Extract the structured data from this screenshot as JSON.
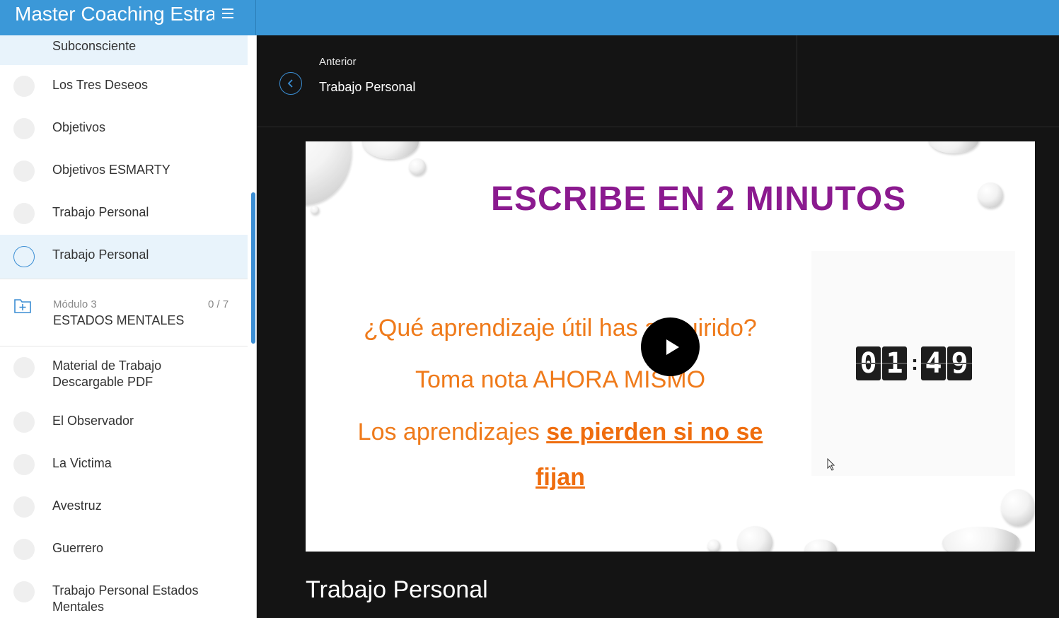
{
  "app": {
    "title": "Master Coaching Estratégico"
  },
  "sidebar": {
    "items_top": [
      {
        "label": "Subconsciente",
        "active": false
      },
      {
        "label": "Los Tres Deseos",
        "active": false
      },
      {
        "label": "Objetivos",
        "active": false
      },
      {
        "label": "Objetivos ESMARTY",
        "active": false
      },
      {
        "label": "Trabajo Personal",
        "active": false
      },
      {
        "label": "Trabajo Personal",
        "active": true
      }
    ],
    "module": {
      "label": "Módulo 3",
      "count": "0 / 7",
      "title": "ESTADOS MENTALES"
    },
    "items_bottom": [
      {
        "label": "Material de Trabajo Descargable PDF"
      },
      {
        "label": "El Observador"
      },
      {
        "label": "La Victima"
      },
      {
        "label": "Avestruz"
      },
      {
        "label": "Guerrero"
      },
      {
        "label": "Trabajo Personal Estados Mentales"
      }
    ]
  },
  "nav": {
    "prev_label": "Anterior",
    "prev_title": "Trabajo Personal"
  },
  "video": {
    "headline": "ESCRIBE EN 2 MINUTOS",
    "line1": "¿Qué aprendizaje útil has adquirido?",
    "line2": "Toma nota AHORA MISMO",
    "line3_prefix": "Los aprendizajes ",
    "line3_emph": "se pierden si no se",
    "line4_emph": "fijan",
    "timer": [
      "0",
      "1",
      "4",
      "9"
    ],
    "timer_sep": ":"
  },
  "lesson": {
    "title": "Trabajo Personal"
  },
  "colors": {
    "accent": "#3b98d8",
    "headline": "#8b1a8f",
    "orange": "#ef7a1a"
  }
}
